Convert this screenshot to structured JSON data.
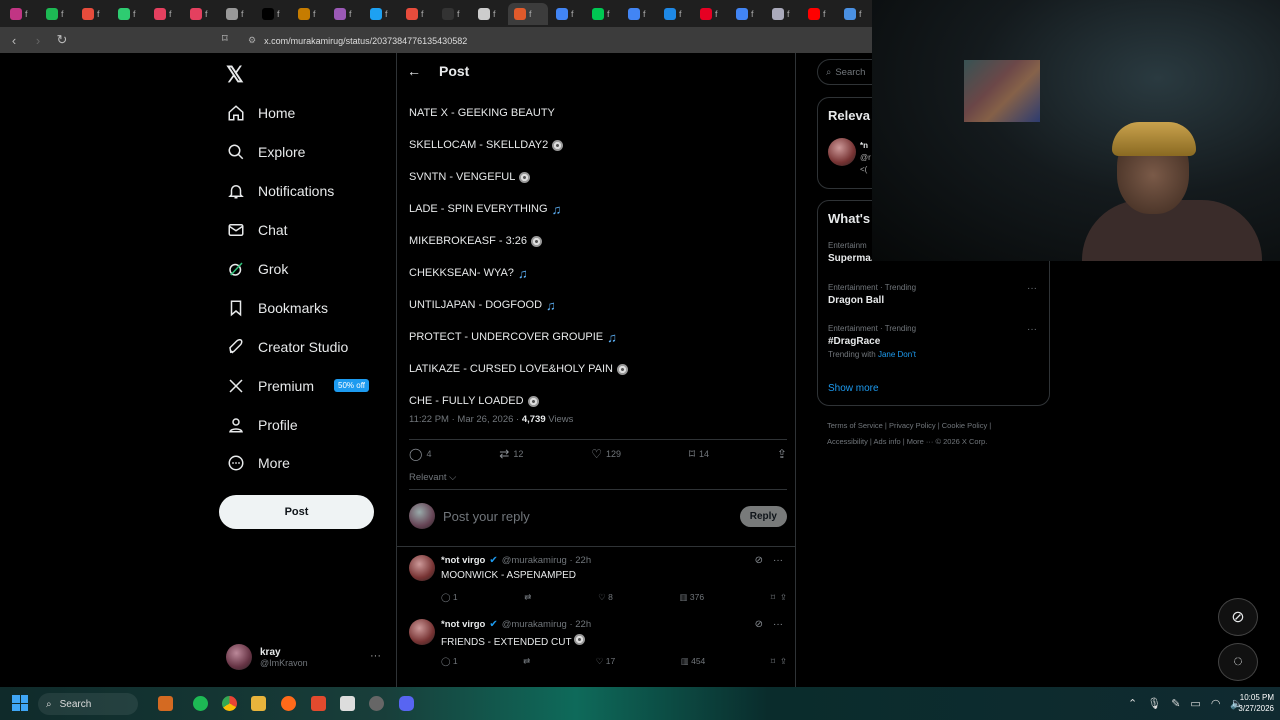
{
  "browser": {
    "url": "x.com/murakamirug/status/2037384776135430582",
    "tab_text": "f"
  },
  "nav": {
    "logo": "𝕏",
    "items": [
      {
        "label": "Home",
        "icon": "home-icon"
      },
      {
        "label": "Explore",
        "icon": "search-icon"
      },
      {
        "label": "Notifications",
        "icon": "bell-icon"
      },
      {
        "label": "Chat",
        "icon": "mail-icon"
      },
      {
        "label": "Grok",
        "icon": "grok-icon"
      },
      {
        "label": "Bookmarks",
        "icon": "bookmark-icon"
      },
      {
        "label": "Creator Studio",
        "icon": "rocket-icon"
      },
      {
        "label": "Premium",
        "icon": "x-icon",
        "badge": "50% off"
      },
      {
        "label": "Profile",
        "icon": "person-icon"
      },
      {
        "label": "More",
        "icon": "more-circle-icon"
      }
    ],
    "post_button": "Post"
  },
  "account": {
    "name": "kray",
    "handle": "@ImKravon"
  },
  "post": {
    "header": "Post",
    "tracks": [
      {
        "text": "NATE X - GEEKING BEAUTY",
        "icon": ""
      },
      {
        "text": "SKELLOCAM - SKELLDAY2",
        "icon": "disc"
      },
      {
        "text": "SVNTN - VENGEFUL",
        "icon": "disc"
      },
      {
        "text": "LADE - SPIN EVERYTHING",
        "icon": "note"
      },
      {
        "text": "MIKEBROKEASF - 3:26",
        "icon": "disc"
      },
      {
        "text": "CHEKKSEAN- WYA?",
        "icon": "note"
      },
      {
        "text": "UNTILJAPAN - DOGFOOD",
        "icon": "note"
      },
      {
        "text": "PROTECT - UNDERCOVER GROUPIE",
        "icon": "note"
      },
      {
        "text": "LATIKAZE - CURSED LOVE&HOLY PAIN",
        "icon": "disc"
      },
      {
        "text": "CHE - FULLY LOADED",
        "icon": "disc"
      }
    ],
    "timestamp": "11:22 PM · Mar 26, 2026 · ",
    "views_count": "4,739",
    "views_label": " Views",
    "stats": {
      "replies": "4",
      "reposts": "12",
      "likes": "129",
      "bookmarks": "14"
    },
    "sort_label": "Relevant ⌵",
    "reply_placeholder": "Post your reply",
    "reply_button": "Reply"
  },
  "replies": [
    {
      "name": "*not virgo",
      "handle": "@murakamirug · 22h",
      "text": "MOONWICK - ASPENAMPED",
      "replies": "1",
      "likes": "8",
      "views": "376"
    },
    {
      "name": "*not virgo",
      "handle": "@murakamirug · 22h",
      "text": "FRIENDS - EXTENDED CUT",
      "replies": "1",
      "likes": "17",
      "views": "454"
    }
  ],
  "right": {
    "search_placeholder": "Search",
    "relevant_title": "Releva",
    "relevant_snippet_1": "*n",
    "relevant_snippet_2": "@r",
    "relevant_snippet_3": "<(",
    "trends_title": "What's",
    "trends": [
      {
        "category": "Entertainm",
        "name": "Superma..",
        "with": ""
      },
      {
        "category": "Entertainment · Trending",
        "name": "Dragon Ball",
        "with": ""
      },
      {
        "category": "Entertainment · Trending",
        "name": "#DragRace",
        "with_prefix": "Trending with ",
        "with": "Jane Don't"
      }
    ],
    "show_more": "Show more",
    "footer_line1": "Terms of Service  |  Privacy Policy  |  Cookie Policy  |",
    "footer_line2": "Accessibility  |  Ads info  |  More ···  © 2026 X Corp."
  },
  "taskbar": {
    "search_label": "Search",
    "time": "10:05 PM",
    "date": "3/27/2026"
  },
  "colors": {
    "accent": "#1d9bf0",
    "background": "#000000",
    "text": "#e7e9ea",
    "muted": "#71767b"
  }
}
